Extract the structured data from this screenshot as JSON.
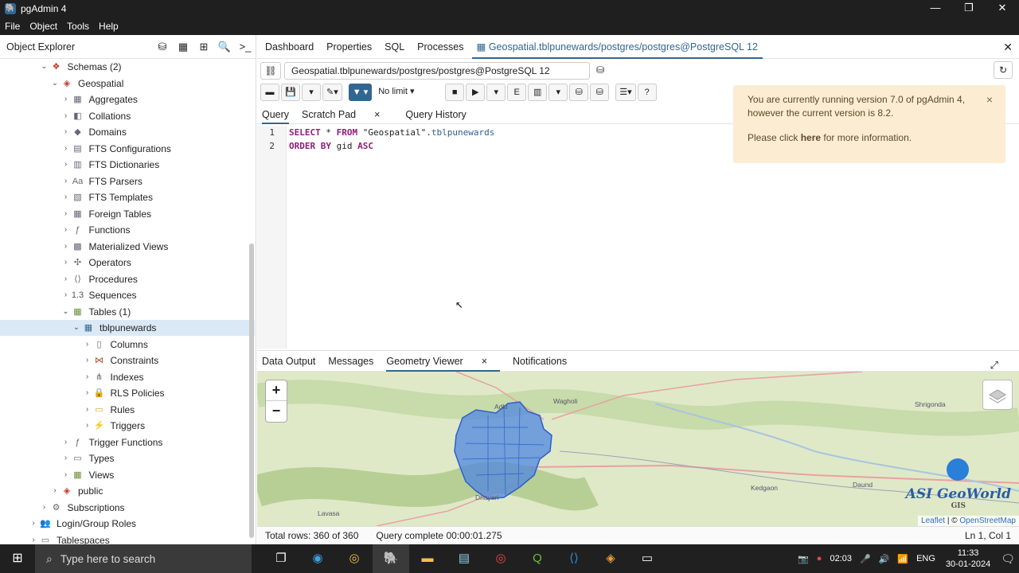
{
  "window": {
    "title": "pgAdmin 4",
    "icon": "elephant-icon",
    "min": "—",
    "max": "❐",
    "close": "✕"
  },
  "menu": [
    "File",
    "Object",
    "Tools",
    "Help"
  ],
  "object_explorer": {
    "title": "Object Explorer",
    "tree": [
      {
        "label": "Schemas (2)",
        "icon": "schemas-icon",
        "depth": 3,
        "expanded": true
      },
      {
        "label": "Geospatial",
        "icon": "schema-icon",
        "depth": 4,
        "expanded": true
      },
      {
        "label": "Aggregates",
        "icon": "aggregate-icon",
        "depth": 5
      },
      {
        "label": "Collations",
        "icon": "collation-icon",
        "depth": 5
      },
      {
        "label": "Domains",
        "icon": "domain-icon",
        "depth": 5
      },
      {
        "label": "FTS Configurations",
        "icon": "fts-config-icon",
        "depth": 5
      },
      {
        "label": "FTS Dictionaries",
        "icon": "fts-dict-icon",
        "depth": 5
      },
      {
        "label": "FTS Parsers",
        "icon": "fts-parser-icon",
        "depth": 5
      },
      {
        "label": "FTS Templates",
        "icon": "fts-template-icon",
        "depth": 5
      },
      {
        "label": "Foreign Tables",
        "icon": "foreign-table-icon",
        "depth": 5
      },
      {
        "label": "Functions",
        "icon": "function-icon",
        "depth": 5
      },
      {
        "label": "Materialized Views",
        "icon": "matview-icon",
        "depth": 5
      },
      {
        "label": "Operators",
        "icon": "operator-icon",
        "depth": 5
      },
      {
        "label": "Procedures",
        "icon": "procedure-icon",
        "depth": 5
      },
      {
        "label": "Sequences",
        "icon": "sequence-icon",
        "depth": 5
      },
      {
        "label": "Tables (1)",
        "icon": "tables-icon",
        "depth": 5,
        "expanded": true
      },
      {
        "label": "tblpunewards",
        "icon": "table-icon",
        "depth": 6,
        "expanded": true,
        "selected": true
      },
      {
        "label": "Columns",
        "icon": "columns-icon",
        "depth": 7
      },
      {
        "label": "Constraints",
        "icon": "constraints-icon",
        "depth": 7
      },
      {
        "label": "Indexes",
        "icon": "indexes-icon",
        "depth": 7
      },
      {
        "label": "RLS Policies",
        "icon": "rls-icon",
        "depth": 7
      },
      {
        "label": "Rules",
        "icon": "rules-icon",
        "depth": 7
      },
      {
        "label": "Triggers",
        "icon": "triggers-icon",
        "depth": 7
      },
      {
        "label": "Trigger Functions",
        "icon": "trigger-function-icon",
        "depth": 5
      },
      {
        "label": "Types",
        "icon": "types-icon",
        "depth": 5
      },
      {
        "label": "Views",
        "icon": "views-icon",
        "depth": 5
      },
      {
        "label": "public",
        "icon": "schema-icon",
        "depth": 4
      },
      {
        "label": "Subscriptions",
        "icon": "subscriptions-icon",
        "depth": 3
      },
      {
        "label": "Login/Group Roles",
        "icon": "roles-icon",
        "depth": 2
      },
      {
        "label": "Tablespaces",
        "icon": "tablespace-icon",
        "depth": 2
      }
    ]
  },
  "main_tabs": [
    "Dashboard",
    "Properties",
    "SQL",
    "Processes"
  ],
  "active_tab": "Geospatial.tblpunewards/postgres/postgres@PostgreSQL 12",
  "connection": "Geospatial.tblpunewards/postgres/postgres@PostgreSQL 12",
  "toolbar": {
    "limit": "No limit"
  },
  "query_tabs": {
    "query": "Query",
    "scratch": "Scratch Pad",
    "scratch_close": "×",
    "history": "Query History"
  },
  "editor": {
    "line_numbers": [
      "1",
      "2"
    ],
    "line1": {
      "kw1": "SELECT",
      "rest1": " * ",
      "kw2": "FROM",
      "str": " \"Geospatial\".",
      "ident": "tblpunewards"
    },
    "line2": {
      "kw1": "ORDER BY",
      "rest": " gid ",
      "kw2": "ASC"
    }
  },
  "notification": {
    "line1": "You are currently running version 7.0 of pgAdmin 4, however the current version is 8.2.",
    "line2_pre": "Please click ",
    "line2_link": "here",
    "line2_post": " for more information.",
    "close": "×"
  },
  "bottom_tabs": {
    "data_output": "Data Output",
    "messages": "Messages",
    "geometry": "Geometry Viewer",
    "geometry_close": "×",
    "notifications": "Notifications"
  },
  "map": {
    "zoom_in": "+",
    "zoom_out": "−",
    "labels": [
      "Wagholi",
      "Shrigonda",
      "Dhayari",
      "Kedgaon",
      "Daund",
      "Lavasa",
      "Adki"
    ],
    "watermark": "ASI GeoWorld",
    "watermark_sub": "GIS",
    "attribution_leaflet": "Leaflet",
    "attribution_sep": " | © ",
    "attribution_osm": "OpenStreetMap",
    "colors": {
      "land": "#dfe9c8",
      "wards_fill": "#4f86e0",
      "wards_stroke": "#2e5fcc",
      "road": "#e7a2a2"
    }
  },
  "status": {
    "total_rows": "Total rows: 360 of 360",
    "query": "Query complete 00:00:01.275",
    "cursor": "Ln 1, Col 1"
  },
  "taskbar": {
    "search_placeholder": "Type here to search",
    "apps": [
      "task-view-icon",
      "edge-icon",
      "chrome-icon",
      "pgadmin-icon",
      "folder-icon",
      "notepad-icon",
      "chrome-icon",
      "qgis-icon",
      "vscode-icon",
      "brave-icon",
      "terminal-icon"
    ],
    "tray_time_small": "02:03",
    "lang": "ENG",
    "time": "11:33",
    "date": "30-01-2024"
  }
}
